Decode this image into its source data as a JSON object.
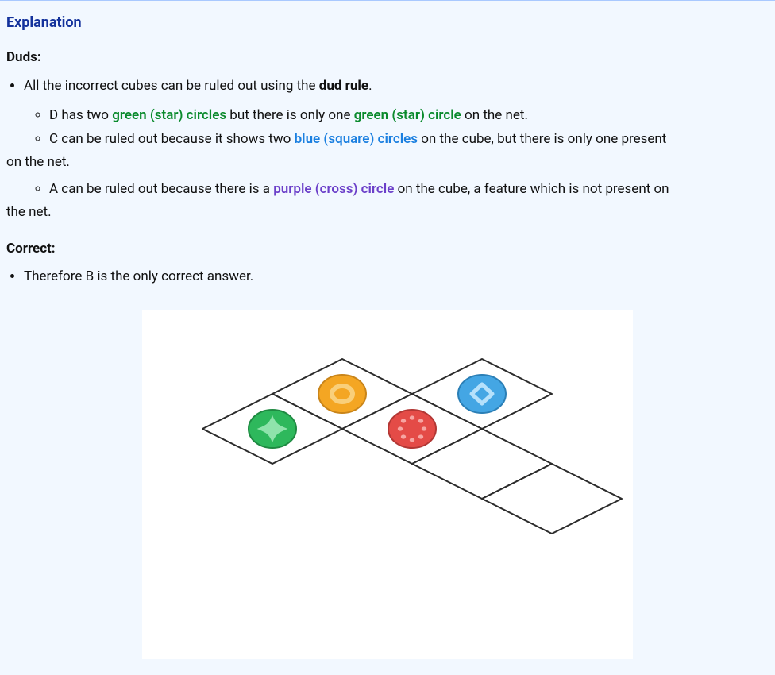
{
  "section_title": "Explanation",
  "duds": {
    "heading": "Duds:",
    "intro_before": "All the incorrect cubes can be ruled out using the ",
    "intro_bold": "dud rule",
    "intro_after": ".",
    "items": [
      {
        "prefix": "D has two ",
        "styled1": "green (star) circles",
        "mid": " but there is only one ",
        "styled2": "green (star) circle",
        "suffix": " on the net."
      },
      {
        "prefix": "C can be ruled out because it shows two ",
        "styled1": "blue (square) circles",
        "mid": " on the cube, but there is only one present",
        "cont": "on the net."
      },
      {
        "prefix": "A can be ruled out because there is a ",
        "styled1": "purple (cross) circle",
        "mid": " on the cube, a feature which is not present on",
        "cont": "the net."
      }
    ]
  },
  "correct": {
    "heading": "Correct:",
    "text": "Therefore B is the only correct answer."
  },
  "figure": {
    "circles": [
      {
        "name": "orange-circle",
        "fill": "#f4a623",
        "inner": "ring"
      },
      {
        "name": "blue-circle",
        "fill": "#3aa6e0",
        "inner": "diamond"
      },
      {
        "name": "red-circle",
        "fill": "#e44b47",
        "inner": "dots"
      },
      {
        "name": "green-circle",
        "fill": "#2eb85c",
        "inner": "star4"
      }
    ]
  }
}
